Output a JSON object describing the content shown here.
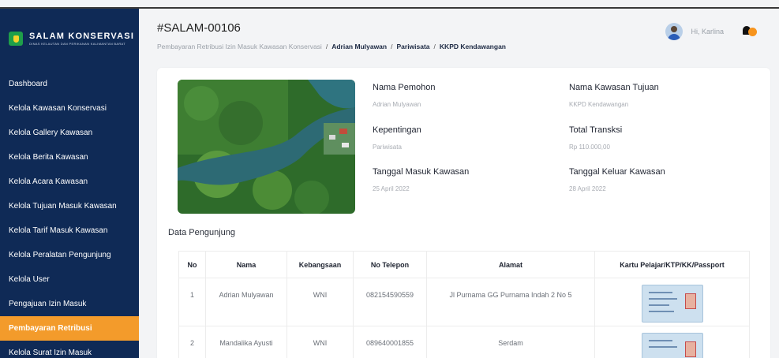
{
  "sidebar": {
    "logo_title": "SALAM KONSERVASI",
    "logo_subtitle": "DINAS KELAUTAN DAN PERIKANAN KALIMANTAN BARAT",
    "items": [
      {
        "label": "Dashboard",
        "active": false
      },
      {
        "label": "Kelola Kawasan Konservasi",
        "active": false
      },
      {
        "label": "Kelola Gallery Kawasan",
        "active": false
      },
      {
        "label": "Kelola Berita Kawasan",
        "active": false
      },
      {
        "label": "Kelola Acara Kawasan",
        "active": false
      },
      {
        "label": "Kelola Tujuan Masuk Kawasan",
        "active": false
      },
      {
        "label": "Kelola Tarif Masuk Kawasan",
        "active": false
      },
      {
        "label": "Kelola Peralatan Pengunjung",
        "active": false
      },
      {
        "label": "Kelola User",
        "active": false
      },
      {
        "label": "Pengajuan Izin Masuk",
        "active": false
      },
      {
        "label": "Pembayaran Retribusi",
        "active": true
      },
      {
        "label": "Kelola Surat Izin Masuk",
        "active": false
      }
    ]
  },
  "header": {
    "title": "#SALAM-00106",
    "breadcrumb": [
      "Pembayaran Retribusi Izin Masuk Kawasan Konservasi",
      "Adrian Mulyawan",
      "Pariwisata",
      "KKPD Kendawangan"
    ],
    "greeting": "Hi, Karlina"
  },
  "detail": {
    "nama_pemohon_label": "Nama Pemohon",
    "nama_pemohon": "Adrian Mulyawan",
    "kepentingan_label": "Kepentingan",
    "kepentingan": "Pariwisata",
    "tanggal_masuk_label": "Tanggal Masuk Kawasan",
    "tanggal_masuk": "25 April 2022",
    "nama_kawasan_label": "Nama Kawasan Tujuan",
    "nama_kawasan": "KKPD Kendawangan",
    "total_label": "Total Transksi",
    "total": "Rp 110.000,00",
    "tanggal_keluar_label": "Tanggal Keluar Kawasan",
    "tanggal_keluar": "28 April 2022"
  },
  "visitors": {
    "section_title": "Data Pengunjung",
    "columns": [
      "No",
      "Nama",
      "Kebangsaan",
      "No Telepon",
      "Alamat",
      "Kartu Pelajar/KTP/KK/Passport"
    ],
    "rows": [
      {
        "no": "1",
        "nama": "Adrian Mulyawan",
        "kebangsaan": "WNI",
        "telepon": "082154590559",
        "alamat": "Jl Purnama GG Purnama Indah 2 No 5"
      },
      {
        "no": "2",
        "nama": "Mandalika Ayusti",
        "kebangsaan": "WNI",
        "telepon": "089640001855",
        "alamat": "Serdam"
      }
    ]
  },
  "colors": {
    "sidebar_bg": "#0f2a56",
    "active_item": "#f39b2b"
  }
}
